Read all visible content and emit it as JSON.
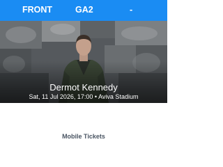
{
  "ticket_header": {
    "section": "FRONT",
    "row": "GA2",
    "seat": "-",
    "background_color": "#1a8cf3",
    "text_color": "#ffffff"
  },
  "event": {
    "artist": "Dermot Kennedy",
    "details": "Sat, 11 Jul 2026, 17:00 • Aviva Stadium"
  },
  "footer": {
    "label": "Mobile Tickets"
  }
}
